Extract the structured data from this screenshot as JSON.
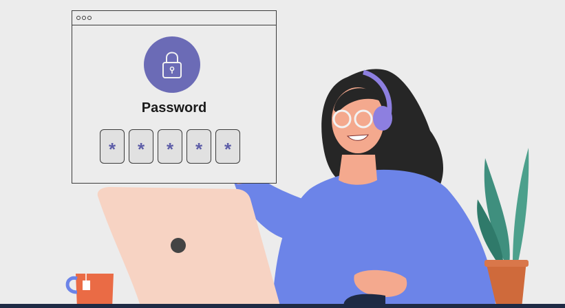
{
  "login_card": {
    "title": "Password",
    "pin_chars": [
      "*",
      "*",
      "*",
      "*",
      "*"
    ]
  },
  "icons": {
    "lock": "padlock-icon",
    "window_controls": "window-dots"
  },
  "colors": {
    "accent_purple": "#6b6bb6",
    "sweater_blue": "#6c84e8",
    "laptop_peach": "#f7d3c3",
    "mug_orange": "#ea6b45",
    "plant_green": "#3f8f7e",
    "pot_orange": "#cf6a3b",
    "hair": "#262626",
    "skin": "#f4a98e",
    "background": "#ececec"
  }
}
